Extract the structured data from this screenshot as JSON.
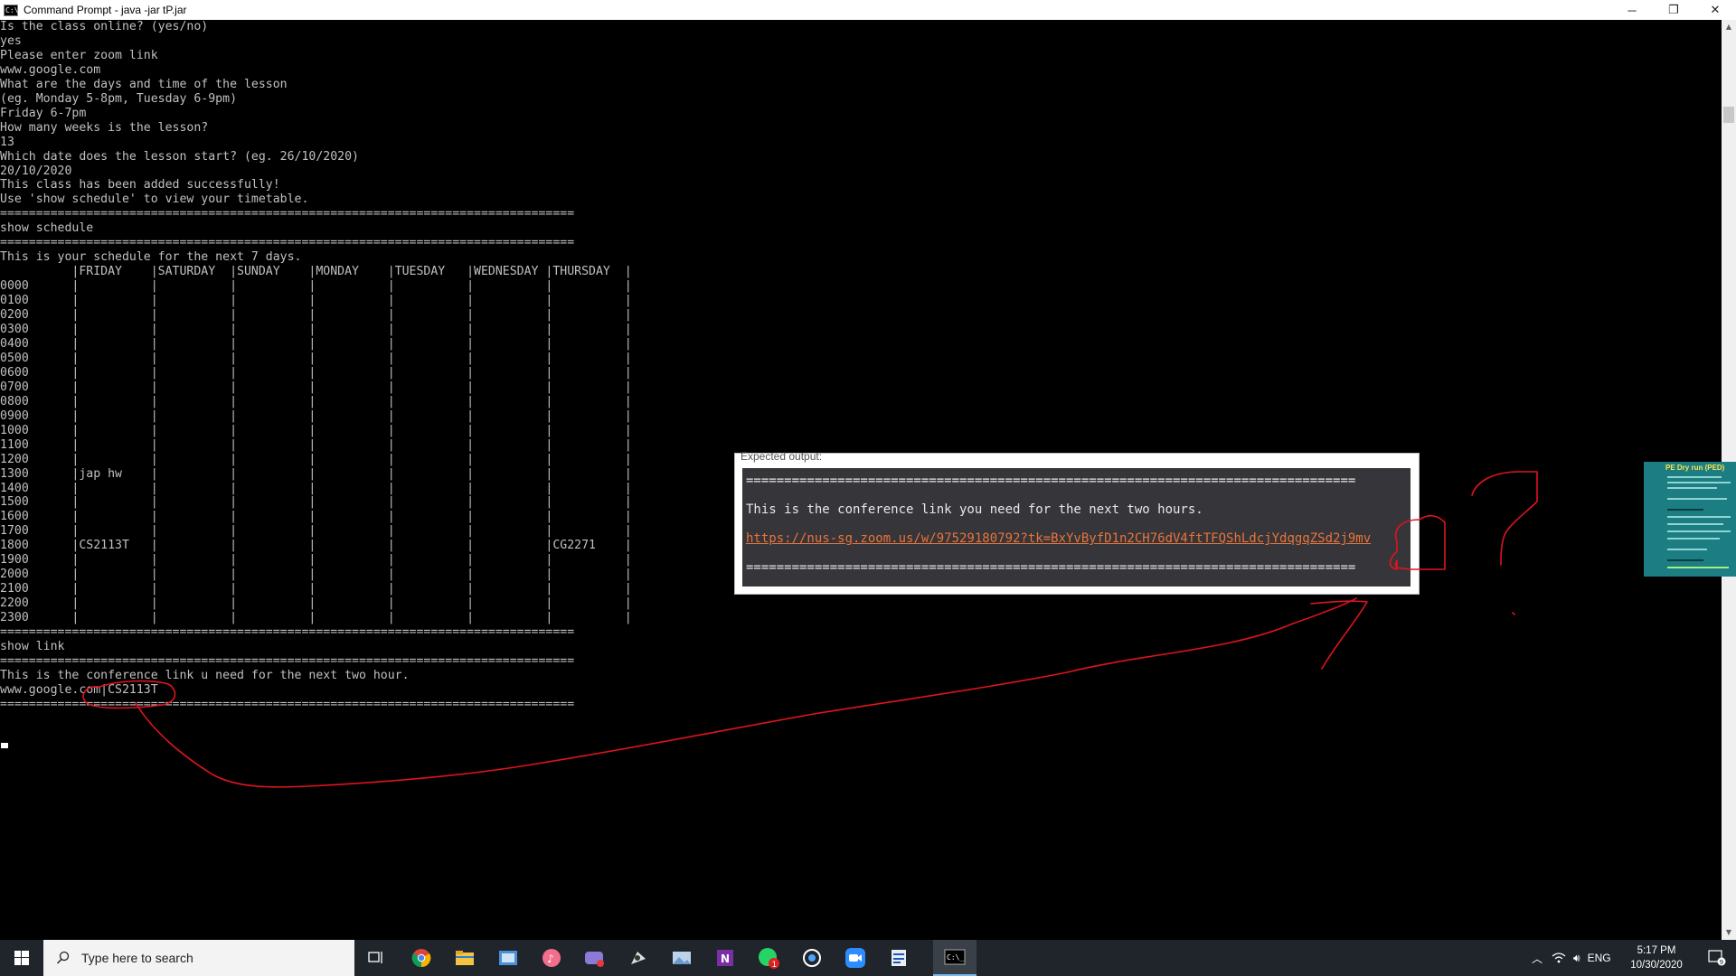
{
  "window": {
    "title": "Command Prompt - java  -jar tP.jar",
    "icon_label": "C:\\",
    "controls": {
      "minimize": "─",
      "restore": "❐",
      "close": "✕"
    }
  },
  "console": {
    "lines": [
      "Is the class online? (yes/no)",
      "yes",
      "Please enter zoom link",
      "www.google.com",
      "What are the days and time of the lesson",
      "(eg. Monday 5-8pm, Tuesday 6-9pm)",
      "Friday 6-7pm",
      "How many weeks is the lesson?",
      "13",
      "Which date does the lesson start? (eg. 26/10/2020)",
      "20/10/2020",
      "This class has been added successfully!",
      "Use 'show schedule' to view your timetable.",
      "================================================================================",
      "show schedule",
      "================================================================================",
      "This is your schedule for the next 7 days.",
      "          |FRIDAY    |SATURDAY  |SUNDAY    |MONDAY    |TUESDAY   |WEDNESDAY |THURSDAY  |",
      "0000      |          |          |          |          |          |          |          |",
      "0100      |          |          |          |          |          |          |          |",
      "0200      |          |          |          |          |          |          |          |",
      "0300      |          |          |          |          |          |          |          |",
      "0400      |          |          |          |          |          |          |          |",
      "0500      |          |          |          |          |          |          |          |",
      "0600      |          |          |          |          |          |          |          |",
      "0700      |          |          |          |          |          |          |          |",
      "0800      |          |          |          |          |          |          |          |",
      "0900      |          |          |          |          |          |          |          |",
      "1000      |          |          |          |          |          |          |          |",
      "1100      |          |          |          |          |          |          |          |",
      "1200      |          |          |          |          |          |          |          |",
      "1300      |jap hw    |          |          |          |          |          |          |",
      "1400      |          |          |          |          |          |          |          |",
      "1500      |          |          |          |          |          |          |          |",
      "1600      |          |          |          |          |          |          |          |",
      "1700      |          |          |          |          |          |          |          |",
      "1800      |CS2113T   |          |          |          |          |          |CG2271    |",
      "1900      |          |          |          |          |          |          |          |",
      "2000      |          |          |          |          |          |          |          |",
      "2100      |          |          |          |          |          |          |          |",
      "2200      |          |          |          |          |          |          |          |",
      "2300      |          |          |          |          |          |          |          |",
      "================================================================================",
      "show link",
      "================================================================================",
      "This is the conference link u need for the next two hour.",
      "www.google.com|CS2113T",
      "================================================================================"
    ]
  },
  "popup": {
    "label": "Expected output:",
    "rule": "================================================================================",
    "message": "This is the conference link you need for the next two hours.",
    "link": "https://nus-sg.zoom.us/w/97529180792?tk=BxYvByfD1n2CH76dV4ftTFQShLdcjYdqgqZSd2j9mv"
  },
  "thumbnail": {
    "title": "PE Dry run (PED)"
  },
  "annotation_color": "#e0141e",
  "taskbar": {
    "search_placeholder": "Type here to search",
    "apps": [
      "task-view",
      "chrome",
      "file-explorer",
      "outlook",
      "itunes",
      "game",
      "inkscape",
      "photos",
      "onenote",
      "whatsapp",
      "app-q",
      "zoom",
      "notepad",
      "command-prompt"
    ],
    "whatsapp_badge": "1",
    "language": "ENG",
    "time": "5:17 PM",
    "date": "10/30/2020",
    "notifications": "9"
  }
}
